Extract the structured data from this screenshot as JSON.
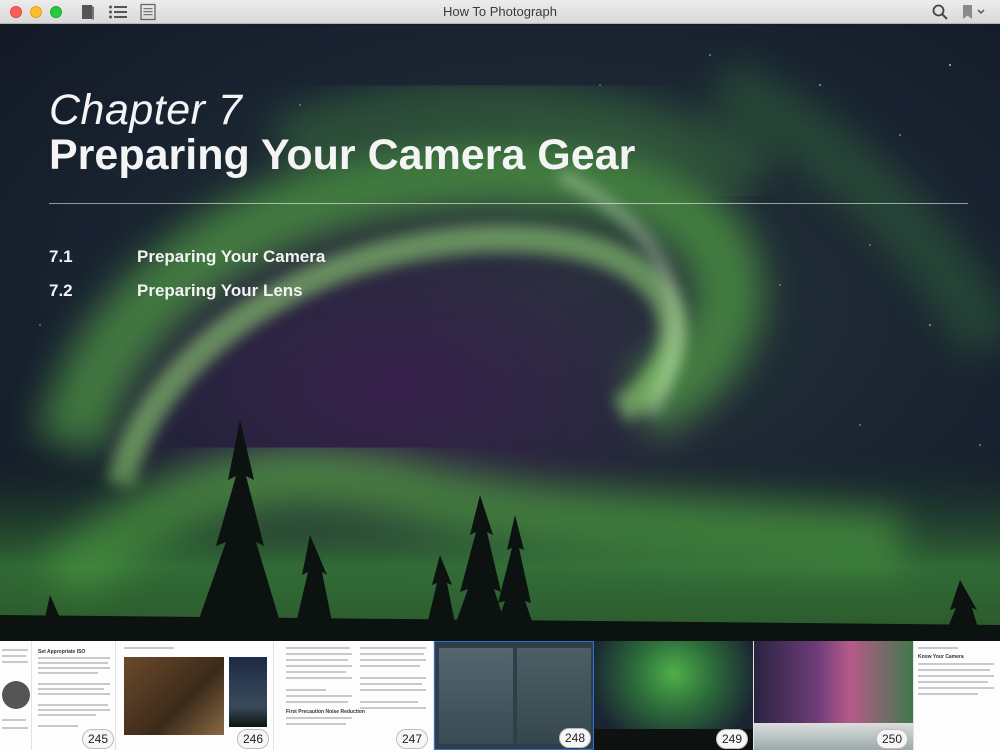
{
  "window": {
    "title": "How To Photograph"
  },
  "toolbar": {
    "library_icon": "book-icon",
    "toc_icon": "list-icon",
    "notes_icon": "notes-icon",
    "search_icon": "search-icon",
    "bookmark_icon": "bookmark-icon"
  },
  "cover": {
    "chapter_label": "Chapter 7",
    "chapter_title": "Preparing Your Camera Gear",
    "toc": [
      {
        "number": "7.1",
        "title": "Preparing Your Camera"
      },
      {
        "number": "7.2",
        "title": "Preparing Your Lens"
      }
    ]
  },
  "pages": [
    {
      "number": "245",
      "heading": "Set Appropriate ISO"
    },
    {
      "number": "246",
      "heading": "Preparing Your Camera"
    },
    {
      "number": "247",
      "heading": "First Precaution Noise Reduction"
    },
    {
      "number": "248",
      "heading": ""
    },
    {
      "number": "249",
      "heading": ""
    },
    {
      "number": "250",
      "heading": "Know Your Camera"
    }
  ],
  "colors": {
    "aurora_green": "#7fdc5a",
    "sky": "#1a2232",
    "selection": "#2f6fd6"
  }
}
